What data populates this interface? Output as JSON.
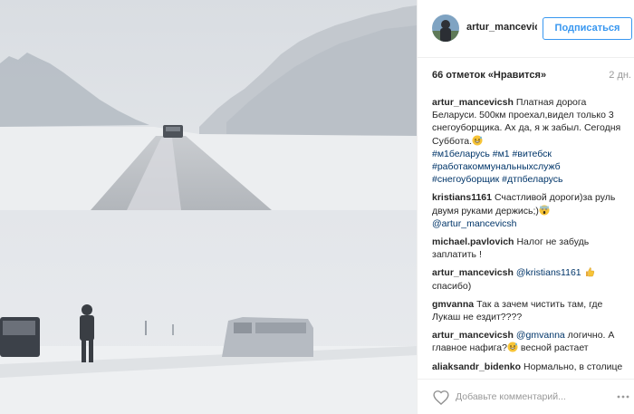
{
  "post": {
    "username": "artur_mancevicsh",
    "follow_label": "Подписаться",
    "likes": "66 отметок «Нравится»",
    "timestamp": "2 дн."
  },
  "comments": [
    {
      "author": "artur_mancevicsh",
      "text": "Платная дорога Беларуси. 500км проехал,видел только 3 снегоуборщика. Ах да, я ж забыл. Сегодня Суббота.",
      "emoji": "grinning-face-sweat-icon",
      "hashtags": "#м1беларусь #м1 #витебск #работакоммунальныхслужб #снегоуборщик #дтпбеларусь"
    },
    {
      "author": "kristians1161",
      "text": "Счастливой дороги)за руль двумя руками держись;)",
      "emoji": "scream-face-icon",
      "mention": "@artur_mancevicsh"
    },
    {
      "author": "michael.pavlovich",
      "text": "Налог не забудь заплатить !"
    },
    {
      "author": "artur_mancevicsh",
      "mention": "@kristians1161",
      "emoji": "thumbs-up-icon",
      "text": "спасибо)"
    },
    {
      "author": "gmvanna",
      "text": "Так а зачем чистить там, где Лукаш не ездит????"
    },
    {
      "author": "artur_mancevicsh",
      "mention": "@gmvanna",
      "text": "логично. А главное нафига?",
      "emoji": "grinning-face-sweat-icon",
      "text2": "весной растает"
    },
    {
      "author": "aliaksandr_bidenko",
      "text": "Нормально, в столице дорога ещё хуже."
    }
  ],
  "footer": {
    "placeholder": "Добавьте комментарий...",
    "like_icon": "heart-outline-icon",
    "more_icon": "more-dots-icon"
  },
  "colors": {
    "follow_blue": "#3897f0",
    "hashtag_link": "#003569",
    "muted_text": "#999999",
    "divider": "#efefef"
  }
}
